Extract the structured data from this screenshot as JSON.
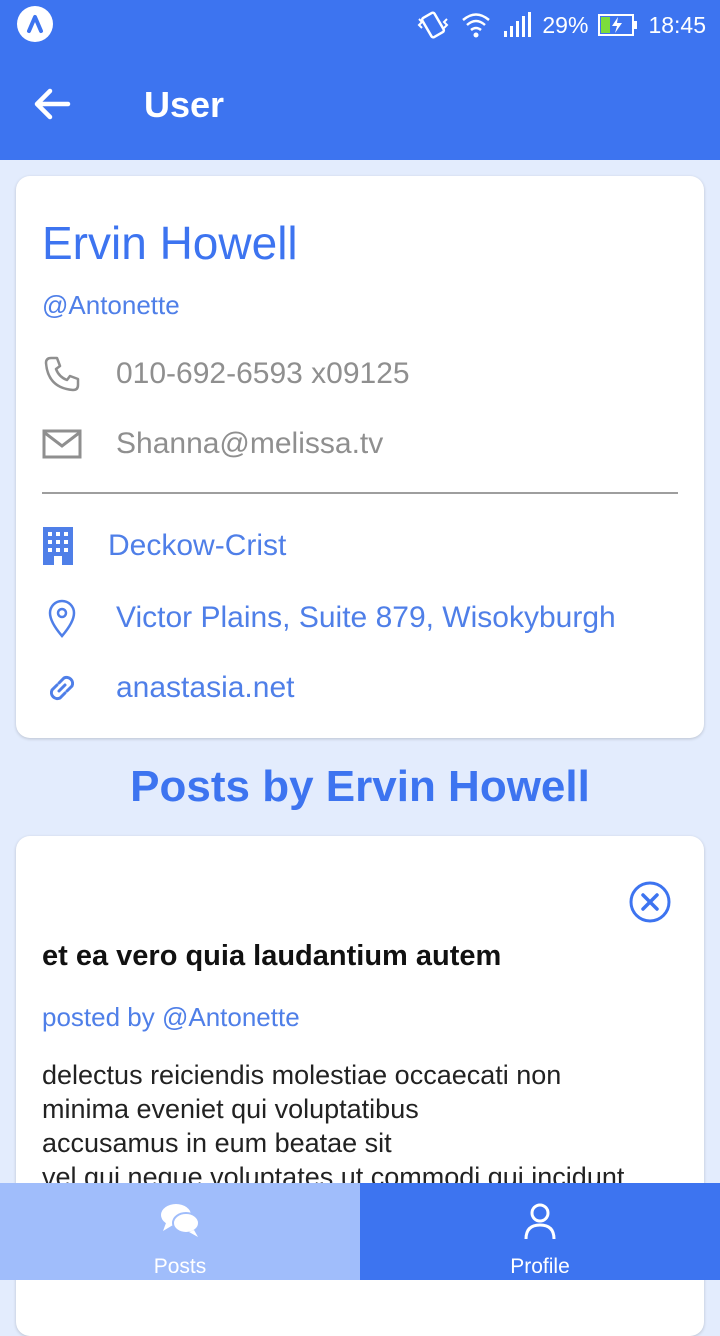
{
  "status_bar": {
    "battery": "29%",
    "time": "18:45"
  },
  "app_bar": {
    "title": "User"
  },
  "user": {
    "name": "Ervin Howell",
    "handle": "@Antonette",
    "phone": "010-692-6593 x09125",
    "email": "Shanna@melissa.tv",
    "company": "Deckow-Crist",
    "address": "Victor Plains, Suite 879, Wisokyburgh",
    "website": "anastasia.net"
  },
  "posts_heading": "Posts by Ervin Howell",
  "post": {
    "title": "et ea vero quia laudantium autem",
    "posted_by": "posted by @Antonette",
    "body_lines": [
      "delectus reiciendis molestiae occaecati non",
      "minima eveniet qui voluptatibus",
      "accusamus in eum beatae sit",
      "vel qui neque voluptates ut commodi qui incidunt"
    ]
  },
  "bottom_nav": {
    "posts_label": "Posts",
    "profile_label": "Profile"
  },
  "icons": {
    "status": [
      "app-launcher-icon",
      "vibrate-icon",
      "wifi-icon",
      "signal-icon",
      "battery-charging-icon"
    ],
    "appbar": "arrow-back-icon",
    "user_rows": [
      "phone-icon",
      "mail-icon",
      "building-icon",
      "location-pin-icon",
      "link-icon"
    ],
    "post": "close-circle-icon",
    "nav": [
      "chat-bubbles-icon",
      "person-icon"
    ]
  },
  "colors": {
    "primary": "#3d74f0",
    "accent_text": "#4f7fe8",
    "background": "#e3ecfd",
    "nav_inactive": "#a0bdfb"
  }
}
